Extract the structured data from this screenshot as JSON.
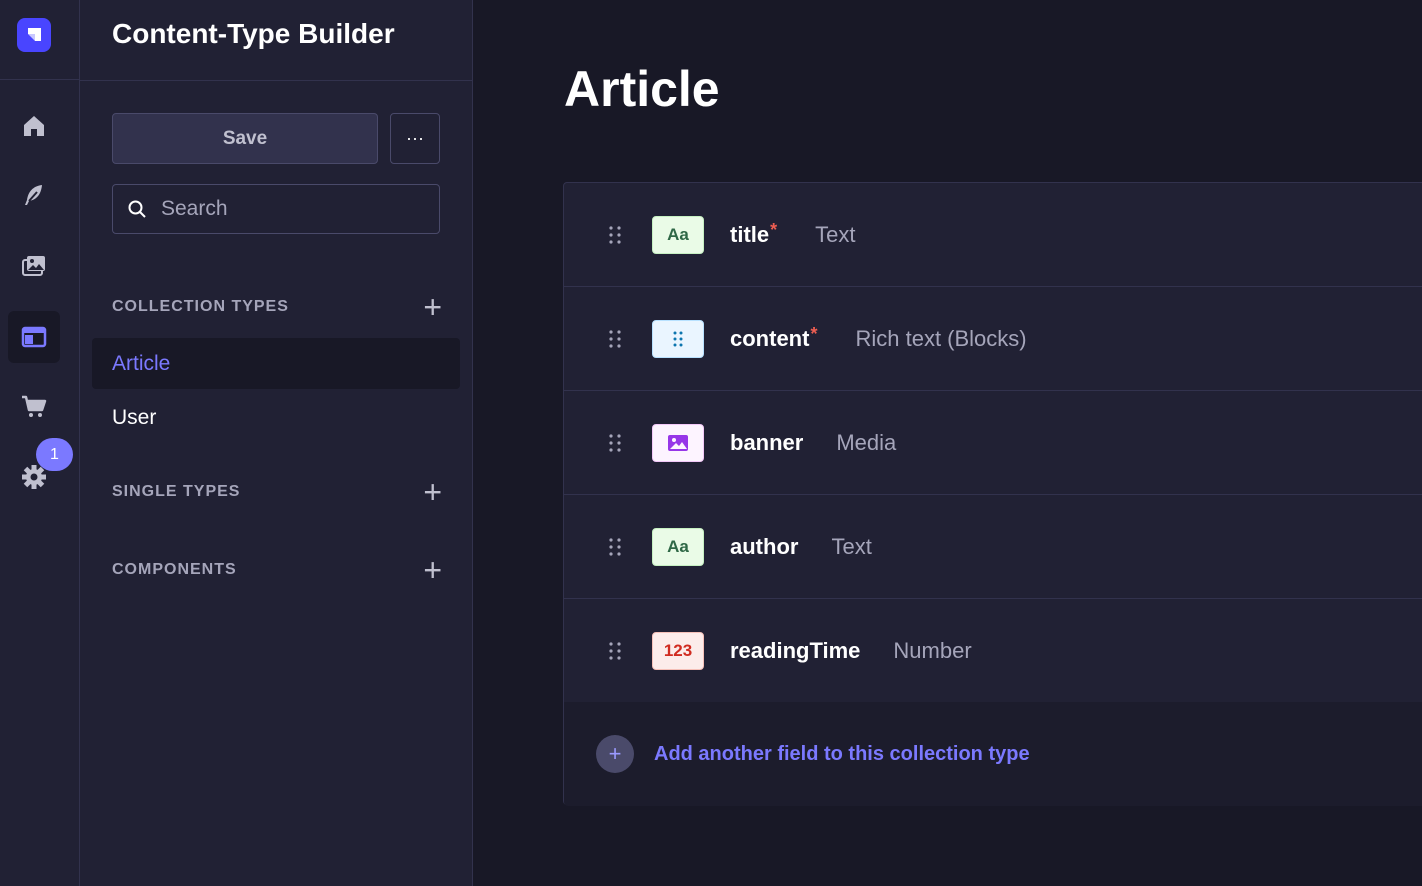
{
  "rail": {
    "badge_count": "1",
    "items": [
      {
        "name": "home-icon"
      },
      {
        "name": "feather-icon"
      },
      {
        "name": "media-library-icon"
      },
      {
        "name": "layout-icon"
      },
      {
        "name": "cart-icon"
      },
      {
        "name": "gear-icon"
      }
    ]
  },
  "subnav": {
    "title": "Content-Type Builder",
    "save_label": "Save",
    "more_label": "···",
    "search_placeholder": "Search",
    "sections": {
      "collection_types": "COLLECTION TYPES",
      "single_types": "SINGLE TYPES",
      "components": "COMPONENTS"
    },
    "collection_items": [
      "Article",
      "User"
    ]
  },
  "main": {
    "title": "Article",
    "fields": [
      {
        "name": "title",
        "required": "*",
        "type": "Text",
        "icon_label": "Aa"
      },
      {
        "name": "content",
        "required": "*",
        "type": "Rich text (Blocks)",
        "icon_label": ""
      },
      {
        "name": "banner",
        "required": "",
        "type": "Media",
        "icon_label": ""
      },
      {
        "name": "author",
        "required": "",
        "type": "Text",
        "icon_label": "Aa"
      },
      {
        "name": "readingTime",
        "required": "",
        "type": "Number",
        "icon_label": "123"
      }
    ],
    "add_field_label": "Add another field to this collection type",
    "add_icon": "+"
  },
  "colors": {
    "accent": "#7b79ff",
    "brand": "#4945ff",
    "required": "#ee5e52"
  }
}
